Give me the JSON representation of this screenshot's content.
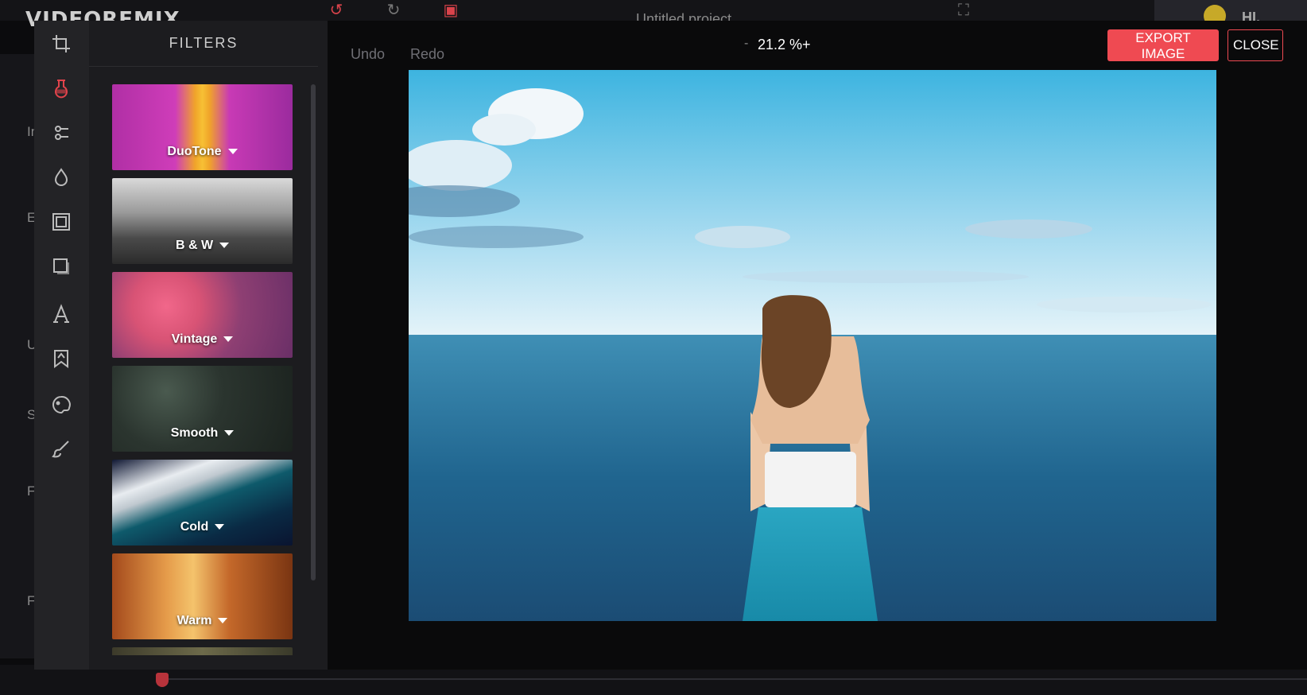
{
  "background_app": {
    "logo": "VIDEOREMIX",
    "project_title": "Untitled project",
    "user_greeting": "HI, BHADI",
    "left_letters": [
      "In",
      "E",
      "U",
      "S",
      "F",
      "F"
    ]
  },
  "editor": {
    "panel_title": "FILTERS",
    "undo_label": "Undo",
    "redo_label": "Redo",
    "zoom_minus": "-",
    "zoom_value": "21.2 %",
    "zoom_plus": "+",
    "export_label": "EXPORT IMAGE",
    "close_label": "CLOSE"
  },
  "tools": [
    {
      "name": "crop-icon"
    },
    {
      "name": "filter-icon",
      "active": true
    },
    {
      "name": "adjust-sliders-icon"
    },
    {
      "name": "droplet-icon"
    },
    {
      "name": "frame-icon"
    },
    {
      "name": "shape-icon"
    },
    {
      "name": "text-icon"
    },
    {
      "name": "sticker-icon"
    },
    {
      "name": "palette-icon"
    },
    {
      "name": "brush-icon"
    }
  ],
  "filters": [
    {
      "label": "DuoTone"
    },
    {
      "label": "B & W"
    },
    {
      "label": "Vintage"
    },
    {
      "label": "Smooth"
    },
    {
      "label": "Cold"
    },
    {
      "label": "Warm"
    }
  ],
  "colors": {
    "accent": "#ef4a52",
    "active_tool": "#e0434b"
  }
}
